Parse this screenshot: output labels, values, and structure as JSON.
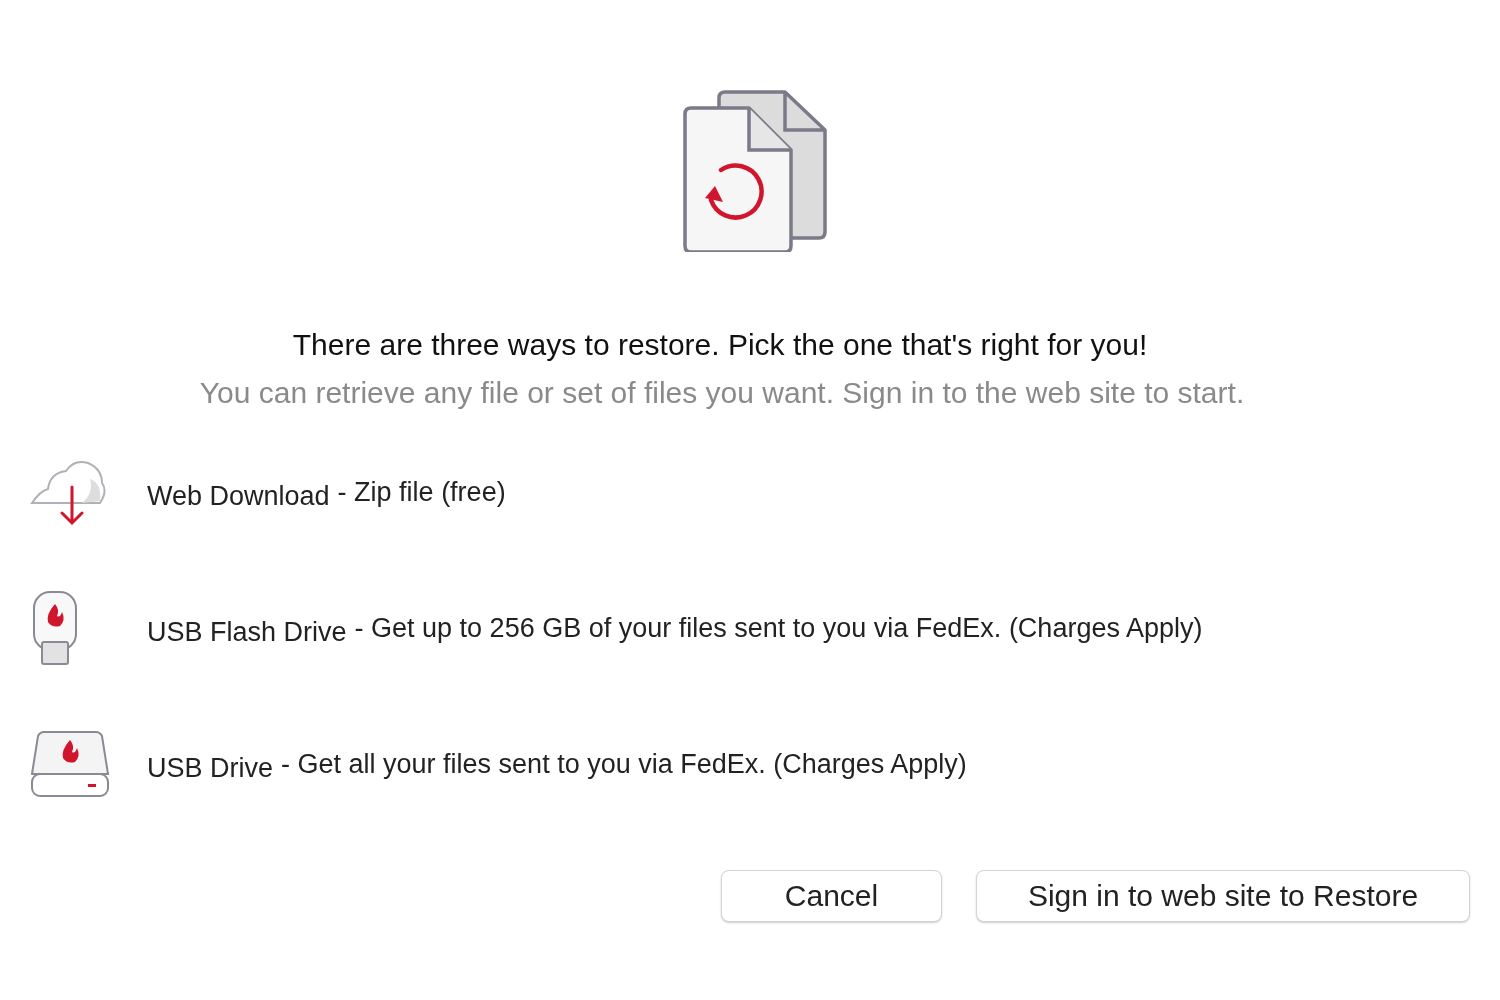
{
  "heading": "There are three ways to restore.  Pick the one that's right for you!",
  "subheading": "You can retrieve any file or set of files you want.  Sign in to the web site to start.",
  "options": [
    {
      "kind": "cloud",
      "name": "Web Download",
      "description": "- Zip file (free)"
    },
    {
      "kind": "flash",
      "name": "USB Flash Drive",
      "description": "- Get up to 256 GB of your files sent to you via FedEx.  (Charges Apply)"
    },
    {
      "kind": "drive",
      "name": "USB Drive",
      "description": "- Get all your files sent to you via FedEx.  (Charges Apply)"
    }
  ],
  "buttons": [
    {
      "label": "Cancel"
    },
    {
      "label": "Sign in to web site to Restore"
    }
  ]
}
